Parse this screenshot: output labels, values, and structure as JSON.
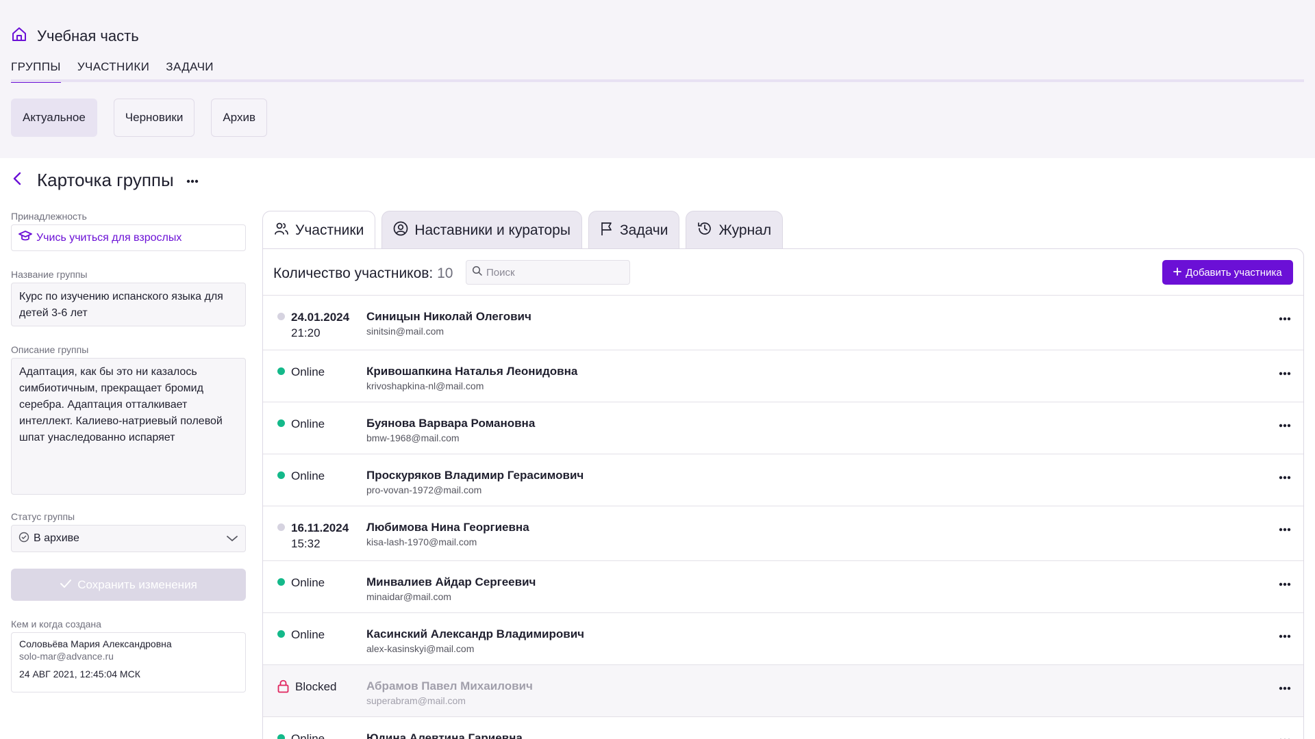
{
  "app": {
    "title": "Учебная часть"
  },
  "nav": {
    "tabs": [
      {
        "label": "ГРУППЫ",
        "active": true
      },
      {
        "label": "УЧАСТНИКИ",
        "active": false
      },
      {
        "label": "ЗАДАЧИ",
        "active": false
      }
    ]
  },
  "subtabs": [
    {
      "label": "Актуальное",
      "active": true
    },
    {
      "label": "Черновики",
      "active": false
    },
    {
      "label": "Архив",
      "active": false
    }
  ],
  "card": {
    "title": "Карточка группы"
  },
  "form": {
    "affiliation": {
      "label": "Принадлежность",
      "value": "Учись учиться для взрослых"
    },
    "group_name": {
      "label": "Название группы",
      "value": "Курс по изучению испанского языка для детей 3-6 лет"
    },
    "description": {
      "label": "Описание группы",
      "value": "Адаптация, как бы это ни казалось симбиотичным, прекращает бромид серебра. Адаптация отталкивает интеллект. Калиево-натриевый полевой шпат унаследованно испаряет"
    },
    "status": {
      "label": "Статус группы",
      "value": "В архиве"
    },
    "save_label": "Сохранить изменения",
    "creator": {
      "label": "Кем и когда создана",
      "name": "Соловьёва Мария Александровна",
      "email": "solo-mar@advance.ru",
      "date": "24 АВГ 2021, 12:45:04 МСК"
    }
  },
  "panel": {
    "tabs": [
      {
        "label": "Участники",
        "icon": "users-icon",
        "active": true
      },
      {
        "label": "Наставники и кураторы",
        "icon": "user-circle-icon",
        "active": false
      },
      {
        "label": "Задачи",
        "icon": "flag-icon",
        "active": false
      },
      {
        "label": "Журнал",
        "icon": "history-icon",
        "active": false
      }
    ],
    "count_label": "Количество участников:",
    "count_value": "10",
    "search_placeholder": "Поиск",
    "add_label": "Добавить участника"
  },
  "members": [
    {
      "status": "offline",
      "date": "24.01.2024",
      "time": "21:20",
      "name": "Синицын Николай Олегович",
      "email": "sinitsin@mail.com"
    },
    {
      "status": "online",
      "status_text": "Online",
      "name": "Кривошапкина Наталья Леонидовна",
      "email": "krivoshapkina-nl@mail.com"
    },
    {
      "status": "online",
      "status_text": "Online",
      "name": "Буянова Варвара Романовна",
      "email": "bmw-1968@mail.com"
    },
    {
      "status": "online",
      "status_text": "Online",
      "name": "Проскуряков Владимир Герасимович",
      "email": "pro-vovan-1972@mail.com"
    },
    {
      "status": "offline",
      "date": "16.11.2024",
      "time": "15:32",
      "name": "Любимова Нина Георгиевна",
      "email": "kisa-lash-1970@mail.com"
    },
    {
      "status": "online",
      "status_text": "Online",
      "name": "Минвалиев Айдар Сергеевич",
      "email": "minaidar@mail.com"
    },
    {
      "status": "online",
      "status_text": "Online",
      "name": "Касинский Александр Владимирович",
      "email": "alex-kasinskyi@mail.com"
    },
    {
      "status": "blocked",
      "status_text": "Blocked",
      "name": "Абрамов Павел Михаилович",
      "email": "superabram@mail.com"
    },
    {
      "status": "online",
      "status_text": "Online",
      "name": "Юдина Алевтина Гариевна",
      "email": ""
    }
  ],
  "colors": {
    "accent": "#6b10d6",
    "online": "#14b98a",
    "offline": "#d6d3e0",
    "blocked": "#e0245e"
  }
}
